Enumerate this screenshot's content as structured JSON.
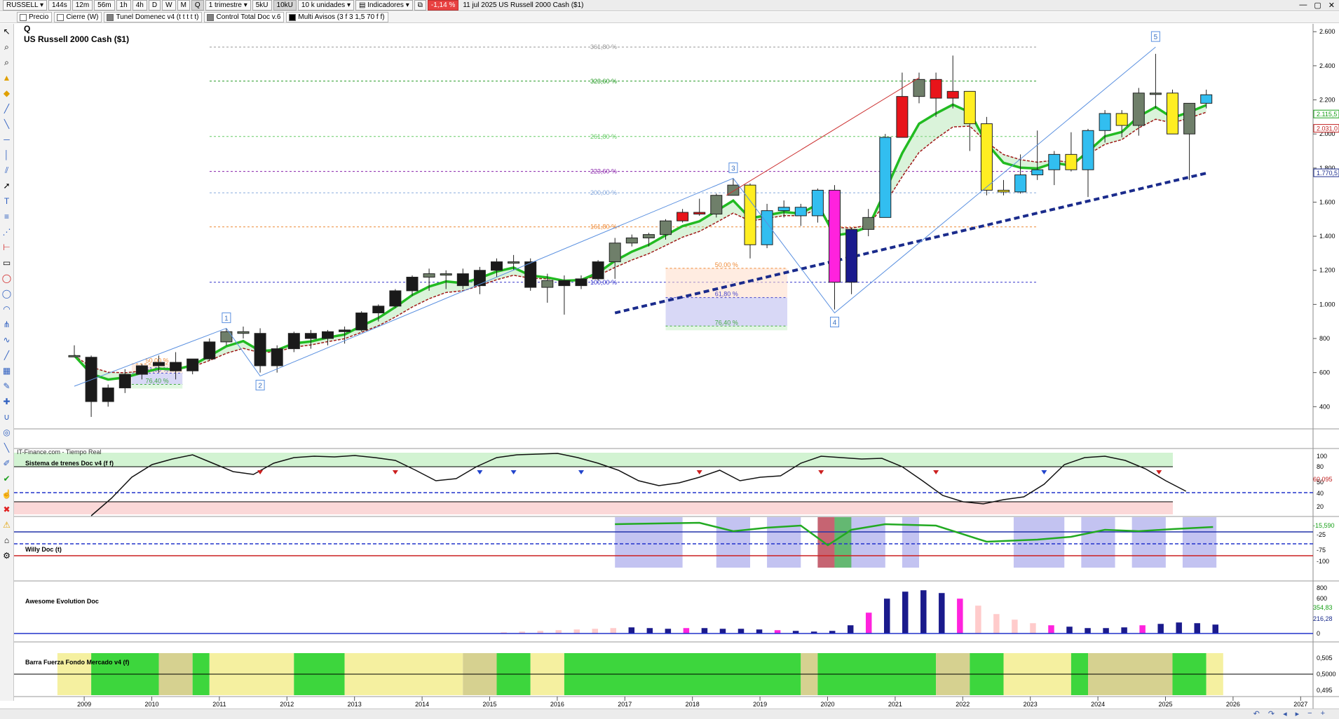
{
  "toolbar": {
    "symbol": "RUSSELL",
    "intervals": [
      "144s",
      "12m",
      "56m",
      "1h",
      "4h",
      "D",
      "W",
      "M",
      "Q"
    ],
    "active_interval": "Q",
    "period": "1 trimestre",
    "units": [
      "5kU",
      "10kU"
    ],
    "active_unit": "10kU",
    "unit_select": "10 k unidades",
    "indicators": "Indicadores",
    "change": "-1,14 %",
    "title": "11 jul 2025  US Russell 2000 Cash ($1)"
  },
  "indicator_bar": [
    {
      "label": "Precio",
      "color": "#ffffff"
    },
    {
      "label": "Cierre (W)",
      "color": "#ffffff"
    },
    {
      "label": "Tunel Domenec v4 (t t t t t)",
      "color": "#808080"
    },
    {
      "label": "Control Total Doc v.6",
      "color": "#808080"
    },
    {
      "label": "Multi Avisos (3 f 3 1,5 70 f f)",
      "color": "#000000"
    }
  ],
  "main": {
    "period_code": "Q",
    "instrument": "US Russell 2000 Cash ($1)",
    "source": "IT-Finance.com - Tiempo Real",
    "y_ticks": [
      {
        "label": "2.600",
        "v": 2600
      },
      {
        "label": "2.400",
        "v": 2400
      },
      {
        "label": "2.200",
        "v": 2200
      },
      {
        "label": "2.000",
        "v": 2000
      },
      {
        "label": "1.800",
        "v": 1800
      },
      {
        "label": "1.600",
        "v": 1600
      },
      {
        "label": "1.400",
        "v": 1400
      },
      {
        "label": "1.200",
        "v": 1200
      },
      {
        "label": "1.000",
        "v": 1000
      },
      {
        "label": "800",
        "v": 800
      },
      {
        "label": "600",
        "v": 600
      },
      {
        "label": "400",
        "v": 400
      }
    ],
    "price_badges": [
      {
        "label": "2.115,5",
        "v": 2115,
        "color": "#18a018"
      },
      {
        "label": "2.031,0",
        "v": 2031,
        "color": "#c02020"
      },
      {
        "label": "1.770,5",
        "v": 1770,
        "color": "#1a2b8c"
      }
    ],
    "fib_levels": [
      {
        "label": "361,80 %",
        "v": 2510,
        "color": "#999999"
      },
      {
        "label": "323,60 %",
        "v": 2310,
        "color": "#229922"
      },
      {
        "label": "261,80 %",
        "v": 1985,
        "color": "#66cc66"
      },
      {
        "label": "223,60 %",
        "v": 1780,
        "color": "#8822aa"
      },
      {
        "label": "200,00 %",
        "v": 1655,
        "color": "#88aadd"
      },
      {
        "label": "161,80 %",
        "v": 1455,
        "color": "#ee8833"
      },
      {
        "label": "100,00 %",
        "v": 1130,
        "color": "#3333cc"
      }
    ],
    "retracements": [
      {
        "labels": [
          "50,00 %",
          "61,80 %",
          "76,40 %"
        ],
        "years": [
          2009.6,
          2010.35
        ],
        "v": [
          651,
          597,
          531
        ]
      },
      {
        "labels": [
          "50,00 %",
          "61,80 %",
          "76,40 %"
        ],
        "years": [
          2017.5,
          2019.3
        ],
        "v": [
          1212,
          1040,
          873
        ]
      }
    ],
    "waves": [
      {
        "label": "1",
        "year": 2011.0,
        "v": 860
      },
      {
        "label": "2",
        "year": 2011.5,
        "v": 580
      },
      {
        "label": "3",
        "year": 2018.5,
        "v": 1740
      },
      {
        "label": "4",
        "year": 2020.0,
        "v": 950
      },
      {
        "label": "5",
        "year": 2024.75,
        "v": 2510
      }
    ]
  },
  "chart_data": {
    "type": "candlestick",
    "title": "US Russell 2000 Cash ($1)",
    "x_labels": [
      "2009",
      "2010",
      "2011",
      "2012",
      "2013",
      "2014",
      "2015",
      "2016",
      "2017",
      "2018",
      "2019",
      "2020",
      "2021",
      "2022",
      "2023",
      "2024",
      "2025",
      "2026",
      "2027"
    ],
    "ylim": [
      280,
      2640
    ],
    "candles": [
      {
        "t": 2008.75,
        "o": 700,
        "h": 760,
        "l": 690,
        "c": 700,
        "col": "dark"
      },
      {
        "t": 2009.0,
        "o": 690,
        "h": 700,
        "l": 340,
        "c": 430,
        "col": "black"
      },
      {
        "t": 2009.25,
        "o": 430,
        "h": 530,
        "l": 400,
        "c": 510,
        "col": "black"
      },
      {
        "t": 2009.5,
        "o": 510,
        "h": 620,
        "l": 480,
        "c": 590,
        "col": "black"
      },
      {
        "t": 2009.75,
        "o": 590,
        "h": 650,
        "l": 560,
        "c": 640,
        "col": "black"
      },
      {
        "t": 2010.0,
        "o": 640,
        "h": 700,
        "l": 600,
        "c": 660,
        "col": "black"
      },
      {
        "t": 2010.25,
        "o": 660,
        "h": 720,
        "l": 560,
        "c": 610,
        "col": "black"
      },
      {
        "t": 2010.5,
        "o": 610,
        "h": 680,
        "l": 590,
        "c": 680,
        "col": "black"
      },
      {
        "t": 2010.75,
        "o": 680,
        "h": 800,
        "l": 670,
        "c": 780,
        "col": "black"
      },
      {
        "t": 2011.0,
        "o": 780,
        "h": 860,
        "l": 760,
        "c": 840,
        "col": "dark"
      },
      {
        "t": 2011.25,
        "o": 840,
        "h": 870,
        "l": 800,
        "c": 830,
        "col": "dark"
      },
      {
        "t": 2011.5,
        "o": 830,
        "h": 860,
        "l": 600,
        "c": 640,
        "col": "black"
      },
      {
        "t": 2011.75,
        "o": 640,
        "h": 760,
        "l": 600,
        "c": 740,
        "col": "black"
      },
      {
        "t": 2012.0,
        "o": 740,
        "h": 840,
        "l": 720,
        "c": 830,
        "col": "black"
      },
      {
        "t": 2012.25,
        "o": 830,
        "h": 850,
        "l": 740,
        "c": 800,
        "col": "black"
      },
      {
        "t": 2012.5,
        "o": 800,
        "h": 850,
        "l": 760,
        "c": 840,
        "col": "black"
      },
      {
        "t": 2012.75,
        "o": 840,
        "h": 870,
        "l": 770,
        "c": 850,
        "col": "black"
      },
      {
        "t": 2013.0,
        "o": 850,
        "h": 960,
        "l": 840,
        "c": 950,
        "col": "black"
      },
      {
        "t": 2013.25,
        "o": 950,
        "h": 1000,
        "l": 900,
        "c": 990,
        "col": "black"
      },
      {
        "t": 2013.5,
        "o": 990,
        "h": 1090,
        "l": 980,
        "c": 1080,
        "col": "black"
      },
      {
        "t": 2013.75,
        "o": 1080,
        "h": 1170,
        "l": 1050,
        "c": 1160,
        "col": "black"
      },
      {
        "t": 2014.0,
        "o": 1160,
        "h": 1210,
        "l": 1080,
        "c": 1180,
        "col": "dark"
      },
      {
        "t": 2014.25,
        "o": 1180,
        "h": 1200,
        "l": 1090,
        "c": 1180,
        "col": "dark"
      },
      {
        "t": 2014.5,
        "o": 1180,
        "h": 1210,
        "l": 1090,
        "c": 1110,
        "col": "black"
      },
      {
        "t": 2014.75,
        "o": 1110,
        "h": 1220,
        "l": 1060,
        "c": 1200,
        "col": "black"
      },
      {
        "t": 2015.0,
        "o": 1200,
        "h": 1270,
        "l": 1160,
        "c": 1250,
        "col": "black"
      },
      {
        "t": 2015.25,
        "o": 1250,
        "h": 1290,
        "l": 1200,
        "c": 1250,
        "col": "dark"
      },
      {
        "t": 2015.5,
        "o": 1250,
        "h": 1270,
        "l": 1080,
        "c": 1100,
        "col": "black"
      },
      {
        "t": 2015.75,
        "o": 1100,
        "h": 1180,
        "l": 1010,
        "c": 1140,
        "col": "dark"
      },
      {
        "t": 2016.0,
        "o": 1140,
        "h": 1170,
        "l": 940,
        "c": 1110,
        "col": "black"
      },
      {
        "t": 2016.25,
        "o": 1110,
        "h": 1170,
        "l": 1090,
        "c": 1150,
        "col": "black"
      },
      {
        "t": 2016.5,
        "o": 1150,
        "h": 1260,
        "l": 1140,
        "c": 1250,
        "col": "black"
      },
      {
        "t": 2016.75,
        "o": 1250,
        "h": 1390,
        "l": 1150,
        "c": 1360,
        "col": "dark"
      },
      {
        "t": 2017.0,
        "o": 1360,
        "h": 1410,
        "l": 1340,
        "c": 1390,
        "col": "dark"
      },
      {
        "t": 2017.25,
        "o": 1390,
        "h": 1420,
        "l": 1340,
        "c": 1410,
        "col": "dark"
      },
      {
        "t": 2017.5,
        "o": 1410,
        "h": 1500,
        "l": 1380,
        "c": 1490,
        "col": "dark"
      },
      {
        "t": 2017.75,
        "o": 1490,
        "h": 1560,
        "l": 1480,
        "c": 1540,
        "col": "red"
      },
      {
        "t": 2018.0,
        "o": 1540,
        "h": 1620,
        "l": 1520,
        "c": 1530,
        "col": "red"
      },
      {
        "t": 2018.25,
        "o": 1530,
        "h": 1650,
        "l": 1510,
        "c": 1640,
        "col": "dark"
      },
      {
        "t": 2018.5,
        "o": 1640,
        "h": 1740,
        "l": 1640,
        "c": 1700,
        "col": "dark"
      },
      {
        "t": 2018.75,
        "o": 1700,
        "h": 1710,
        "l": 1270,
        "c": 1350,
        "col": "yellow"
      },
      {
        "t": 2019.0,
        "o": 1350,
        "h": 1590,
        "l": 1330,
        "c": 1550,
        "col": "cyan"
      },
      {
        "t": 2019.25,
        "o": 1550,
        "h": 1610,
        "l": 1510,
        "c": 1570,
        "col": "cyan"
      },
      {
        "t": 2019.5,
        "o": 1570,
        "h": 1590,
        "l": 1460,
        "c": 1520,
        "col": "cyan"
      },
      {
        "t": 2019.75,
        "o": 1520,
        "h": 1680,
        "l": 1480,
        "c": 1670,
        "col": "cyan"
      },
      {
        "t": 2020.0,
        "o": 1670,
        "h": 1700,
        "l": 970,
        "c": 1130,
        "col": "magenta"
      },
      {
        "t": 2020.25,
        "o": 1130,
        "h": 1450,
        "l": 1060,
        "c": 1440,
        "col": "navy"
      },
      {
        "t": 2020.5,
        "o": 1440,
        "h": 1560,
        "l": 1400,
        "c": 1510,
        "col": "dark"
      },
      {
        "t": 2020.75,
        "o": 1510,
        "h": 2000,
        "l": 1510,
        "c": 1980,
        "col": "cyan"
      },
      {
        "t": 2021.0,
        "o": 1980,
        "h": 2360,
        "l": 1980,
        "c": 2220,
        "col": "red"
      },
      {
        "t": 2021.25,
        "o": 2220,
        "h": 2360,
        "l": 2180,
        "c": 2320,
        "col": "dark"
      },
      {
        "t": 2021.5,
        "o": 2320,
        "h": 2360,
        "l": 2100,
        "c": 2210,
        "col": "red"
      },
      {
        "t": 2021.75,
        "o": 2210,
        "h": 2460,
        "l": 2150,
        "c": 2250,
        "col": "red"
      },
      {
        "t": 2022.0,
        "o": 2250,
        "h": 2250,
        "l": 1900,
        "c": 2060,
        "col": "yellow"
      },
      {
        "t": 2022.25,
        "o": 2060,
        "h": 2100,
        "l": 1640,
        "c": 1670,
        "col": "yellow"
      },
      {
        "t": 2022.5,
        "o": 1670,
        "h": 1730,
        "l": 1640,
        "c": 1660,
        "col": "yellow"
      },
      {
        "t": 2022.75,
        "o": 1660,
        "h": 1880,
        "l": 1650,
        "c": 1760,
        "col": "cyan"
      },
      {
        "t": 2023.0,
        "o": 1760,
        "h": 2020,
        "l": 1730,
        "c": 1790,
        "col": "cyan"
      },
      {
        "t": 2023.25,
        "o": 1790,
        "h": 1900,
        "l": 1700,
        "c": 1880,
        "col": "cyan"
      },
      {
        "t": 2023.5,
        "o": 1880,
        "h": 2010,
        "l": 1780,
        "c": 1790,
        "col": "yellow"
      },
      {
        "t": 2023.75,
        "o": 1790,
        "h": 2030,
        "l": 1630,
        "c": 2020,
        "col": "cyan"
      },
      {
        "t": 2024.0,
        "o": 2020,
        "h": 2140,
        "l": 1950,
        "c": 2120,
        "col": "cyan"
      },
      {
        "t": 2024.25,
        "o": 2120,
        "h": 2140,
        "l": 1980,
        "c": 2050,
        "col": "yellow"
      },
      {
        "t": 2024.5,
        "o": 2050,
        "h": 2270,
        "l": 1990,
        "c": 2240,
        "col": "dark"
      },
      {
        "t": 2024.75,
        "o": 2240,
        "h": 2470,
        "l": 2150,
        "c": 2240,
        "col": "dark"
      },
      {
        "t": 2025.0,
        "o": 2240,
        "h": 2260,
        "l": 2000,
        "c": 2000,
        "col": "yellow"
      },
      {
        "t": 2025.25,
        "o": 2000,
        "h": 2180,
        "l": 1730,
        "c": 2180,
        "col": "dark"
      },
      {
        "t": 2025.5,
        "o": 2180,
        "h": 2260,
        "l": 2150,
        "c": 2230,
        "col": "cyan"
      }
    ]
  },
  "panels": [
    {
      "name": "sistema",
      "label": "Sistema de trenes Doc v4 (f f)",
      "y_ticks": [
        "100",
        "80",
        "50",
        "40",
        "20"
      ],
      "badge": "60,095"
    },
    {
      "name": "willy",
      "label": "Willy Doc (t)",
      "y_ticks": [
        "-25",
        "-75",
        "-100"
      ],
      "badge": "-15,590"
    },
    {
      "name": "awesome",
      "label": "Awesome Evolution Doc",
      "y_ticks": [
        "800",
        "600",
        "0"
      ],
      "badges": [
        "354,83",
        "216,28"
      ]
    },
    {
      "name": "barra",
      "label": "Barra Fuerza Fondo Mercado v4 (f)",
      "y_ticks": [
        "0,505",
        "0,5000",
        "0,495"
      ]
    }
  ],
  "colors": {
    "green": "#1fbf1f",
    "red": "#e8141a",
    "cyan": "#32bef0",
    "yellow": "#ffee22",
    "magenta": "#ff22dd",
    "navy": "#1a1a8c",
    "dark": "#6f7f6a"
  }
}
